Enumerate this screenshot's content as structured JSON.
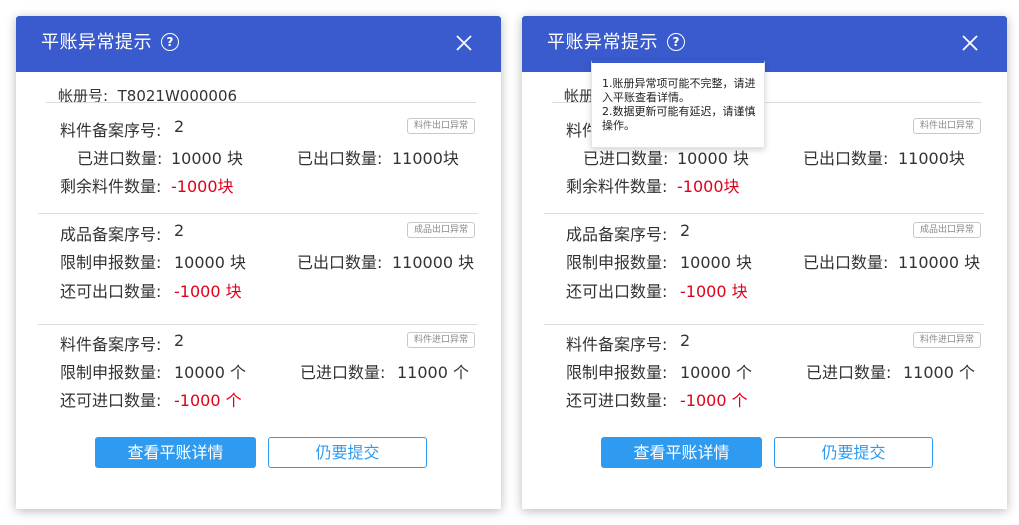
{
  "dialog": {
    "title": "平账异常提示",
    "help_glyph": "?",
    "ledger_label": "帐册号:",
    "ledger_no": "T8021W000006",
    "sections": [
      {
        "key_label": "料件备案序号:",
        "key_value": "2",
        "tag": "料件出口异常",
        "left_label": "已进口数量:",
        "left_value": "10000 块",
        "right_label": "已出口数量:",
        "right_value": "11000块",
        "rem_label": "剩余料件数量:",
        "rem_value": "-1000块"
      },
      {
        "key_label": "成品备案序号:",
        "key_value": "2",
        "tag": "成品出口异常",
        "left_label": "限制申报数量:",
        "left_value": "10000 块",
        "right_label": "已出口数量:",
        "right_value": "110000 块",
        "rem_label": "还可出口数量:",
        "rem_value": "-1000 块"
      },
      {
        "key_label": "料件备案序号:",
        "key_value": "2",
        "tag": "料件进口异常",
        "left_label": "限制申报数量:",
        "left_value": "10000 个",
        "right_label": "已进口数量:",
        "right_value": "11000 个",
        "rem_label": "还可进口数量:",
        "rem_value": "-1000 个"
      }
    ],
    "btn_detail": "查看平账详情",
    "btn_submit": "仍要提交"
  },
  "tooltip": {
    "line1": "1.账册异常项可能不完整，请进入平账查看详情。",
    "line2": "2.数据更新可能有延迟，请谨慎操作。"
  },
  "colors": {
    "header": "#3a5bcd",
    "primary": "#2f9bf0",
    "negative": "#e0001b"
  },
  "icons": [
    "help-icon",
    "close-icon"
  ]
}
